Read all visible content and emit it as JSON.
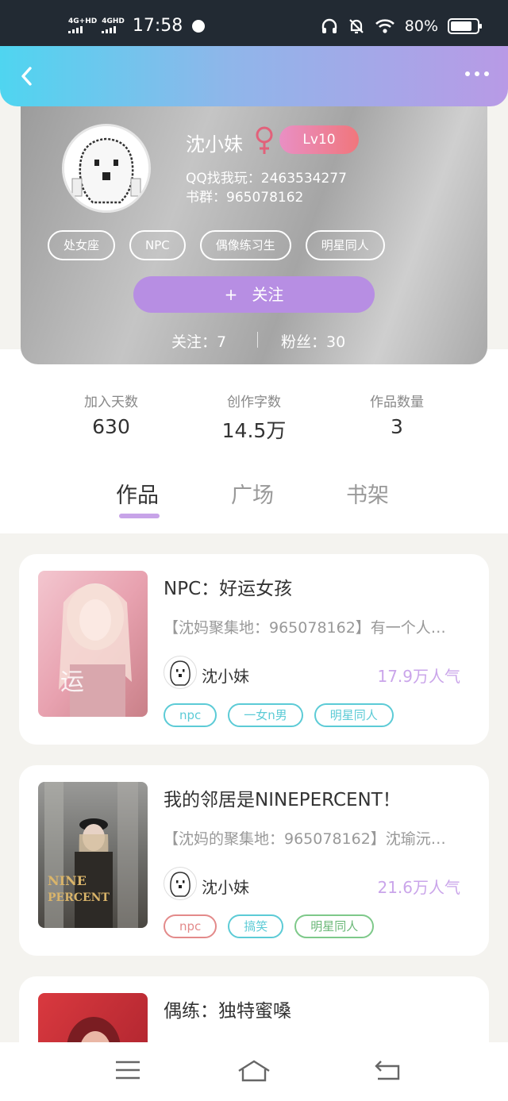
{
  "status_bar": {
    "network_1": "4G+HD",
    "network_2": "4GHD",
    "time": "17:58",
    "battery": "80%",
    "battery_level": 0.8
  },
  "header": {
    "back_icon": "chevron-left-icon",
    "more_icon": "more-dots-icon"
  },
  "profile": {
    "nickname": "沈小妹",
    "gender_icon": "female-icon",
    "level": "Lv10",
    "bio_line1": "QQ找我玩：2463534277",
    "bio_line2": "书群：965078162",
    "tags": [
      "处女座",
      "NPC",
      "偶像练习生",
      "明星同人"
    ],
    "follow_label": "关注",
    "follow_plus": "+",
    "following_label": "关注：7",
    "fans_label": "粉丝：30"
  },
  "stats": [
    {
      "label": "加入天数",
      "value": "630"
    },
    {
      "label": "创作字数",
      "value": "14.5万"
    },
    {
      "label": "作品数量",
      "value": "3"
    }
  ],
  "tabs": [
    "作品",
    "广场",
    "书架"
  ],
  "books": [
    {
      "title": "NPC：好运女孩",
      "desc": "【沈妈聚集地：965078162】有一个人…",
      "author": "沈小妹",
      "popularity": "17.9万人气",
      "tags": [
        {
          "label": "npc"
        },
        {
          "label": "一女n男"
        },
        {
          "label": "明星同人"
        }
      ]
    },
    {
      "title": "我的邻居是NINEPERCENT！",
      "desc": "【沈妈的聚集地：965078162】沈瑜沅…",
      "author": "沈小妹",
      "popularity": "21.6万人气",
      "tags": [
        {
          "label": "npc"
        },
        {
          "label": "搞笑"
        },
        {
          "label": "明星同人"
        }
      ]
    },
    {
      "title": "偶练：独特蜜嗓"
    }
  ],
  "nav_bar": {
    "menu_icon": "menu-icon",
    "home_icon": "home-icon",
    "back_icon": "back-icon"
  },
  "colors": {
    "accent_purple": "#b78ee3",
    "popularity": "#caa5ea",
    "tag_teal": "#5ccbd6",
    "tag_red": "#e38a8a",
    "tag_green": "#7ec98a"
  }
}
